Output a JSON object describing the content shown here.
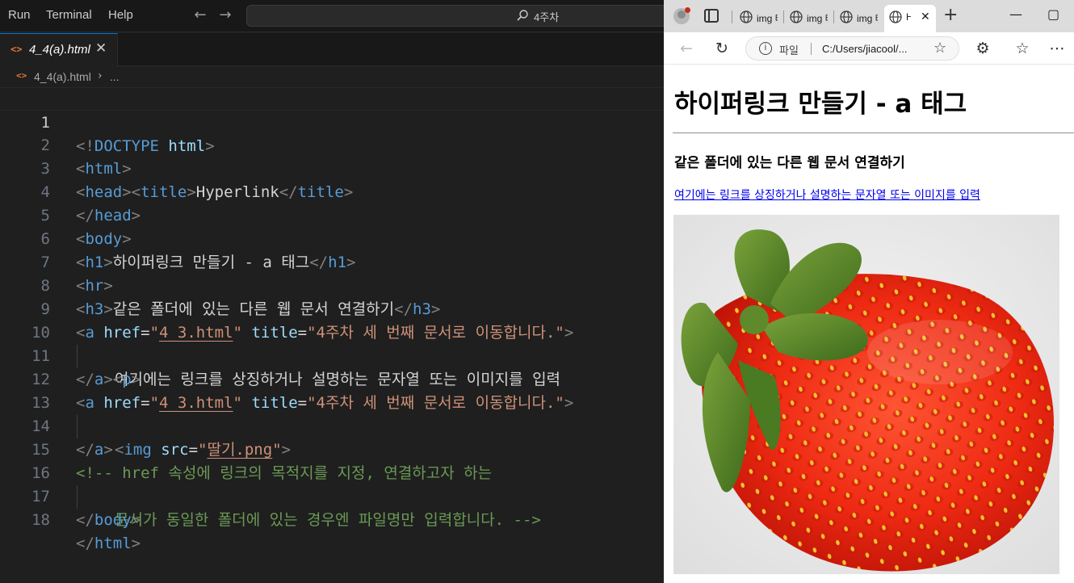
{
  "vscode": {
    "menu": [
      "Run",
      "Terminal",
      "Help"
    ],
    "command_center": "4주차",
    "tab": {
      "icon": "<>",
      "label": "4_4(a).html",
      "close": "✕"
    },
    "breadcrumb": {
      "icon": "<>",
      "file": "4_4(a).html",
      "sep": "›",
      "more": "..."
    },
    "active_line": 1,
    "line_numbers": [
      "1",
      "2",
      "3",
      "4",
      "5",
      "6",
      "7",
      "8",
      "9",
      "10",
      "11",
      "12",
      "13",
      "14",
      "15",
      "16",
      "17",
      "18"
    ]
  },
  "code": {
    "l1": {
      "p1": "<!",
      "kw": "DOCTYPE",
      "sp": " ",
      "attr": "html",
      "p2": ">"
    },
    "l2": {
      "p1": "<",
      "tag": "html",
      "p2": ">"
    },
    "l3": {
      "p1": "<",
      "tag1": "head",
      "p2": "><",
      "tag2": "title",
      "p3": ">",
      "text": "Hyperlink",
      "p4": "</",
      "tag3": "title",
      "p5": ">"
    },
    "l4": {
      "p1": "</",
      "tag": "head",
      "p2": ">"
    },
    "l5": {
      "p1": "<",
      "tag": "body",
      "p2": ">"
    },
    "l6": {
      "p1": "<",
      "tag": "h1",
      "p2": ">",
      "text": "하이퍼링크 만들기 - a 태그",
      "p3": "</",
      "tag2": "h1",
      "p4": ">"
    },
    "l7": {
      "p1": "<",
      "tag": "hr",
      "p2": ">"
    },
    "l8": {
      "p1": "<",
      "tag": "h3",
      "p2": ">",
      "text": "같은 폴더에 있는 다른 웹 문서 연결하기",
      "p3": "</",
      "tag2": "h3",
      "p4": ">"
    },
    "l9": {
      "p1": "<",
      "tag": "a",
      "sp1": " ",
      "attr1": "href",
      "eq1": "=",
      "q1": "\"",
      "val1": "4_3.html",
      "q2": "\"",
      "sp2": " ",
      "attr2": "title",
      "eq2": "=",
      "val2": "\"4주차 세 번째 문서로 이동합니다.\"",
      "p2": ">"
    },
    "l10": {
      "text": "여기에는 링크를 상징하거나 설명하는 문자열 또는 이미지를 입력"
    },
    "l11": {
      "p1": "</",
      "tag": "a",
      "p2": "><",
      "tag2": "p",
      "p3": ">"
    },
    "l12": {
      "p1": "<",
      "tag": "a",
      "sp1": " ",
      "attr1": "href",
      "eq1": "=",
      "q1": "\"",
      "val1": "4_3.html",
      "q2": "\"",
      "sp2": " ",
      "attr2": "title",
      "eq2": "=",
      "val2": "\"4주차 세 번째 문서로 이동합니다.\"",
      "p2": ">"
    },
    "l13": {
      "p1": "<",
      "tag": "img",
      "sp": " ",
      "attr": "src",
      "eq": "=",
      "q1": "\"",
      "val": "딸기.png",
      "q2": "\"",
      "p2": ">"
    },
    "l14": {
      "p1": "</",
      "tag": "a",
      "p2": ">"
    },
    "l15": {
      "text": "<!-- href 속성에 링크의 목적지를 지정, 연결하고자 하는"
    },
    "l16": {
      "text": "문서가 동일한 폴더에 있는 경우엔 파일명만 입력합니다. -->"
    },
    "l17": {
      "p1": "</",
      "tag": "body",
      "p2": ">"
    },
    "l18": {
      "p1": "</",
      "tag": "html",
      "p2": ">"
    }
  },
  "browser": {
    "tabs": [
      {
        "label": "img 태그",
        "icon": "globe-icon"
      },
      {
        "label": "img 태그",
        "icon": "globe-icon"
      },
      {
        "label": "img 태그",
        "icon": "globe-icon"
      },
      {
        "label": "Hyperlink",
        "icon": "globe-icon",
        "active": true
      }
    ],
    "close": "✕",
    "new_tab": "+",
    "window_controls": [
      "—",
      "▢"
    ],
    "address": {
      "scheme": "파일",
      "url": "C:/Users/jiacool/..."
    },
    "page": {
      "h1": "하이퍼링크 만들기 - a 태그",
      "h3": "같은 폴더에 있는 다른 웹 문서 연결하기",
      "link_text": "여기에는 링크를 상징하거나 설명하는 문자열 또는 이미지를 입력",
      "image": "strawberry-image"
    }
  },
  "colors": {
    "editor_bg": "#1f1f1f",
    "tag": "#569cd6",
    "attribute": "#9cdcfe",
    "string": "#ce9178",
    "comment": "#6a9955",
    "link": "#0000ee"
  }
}
